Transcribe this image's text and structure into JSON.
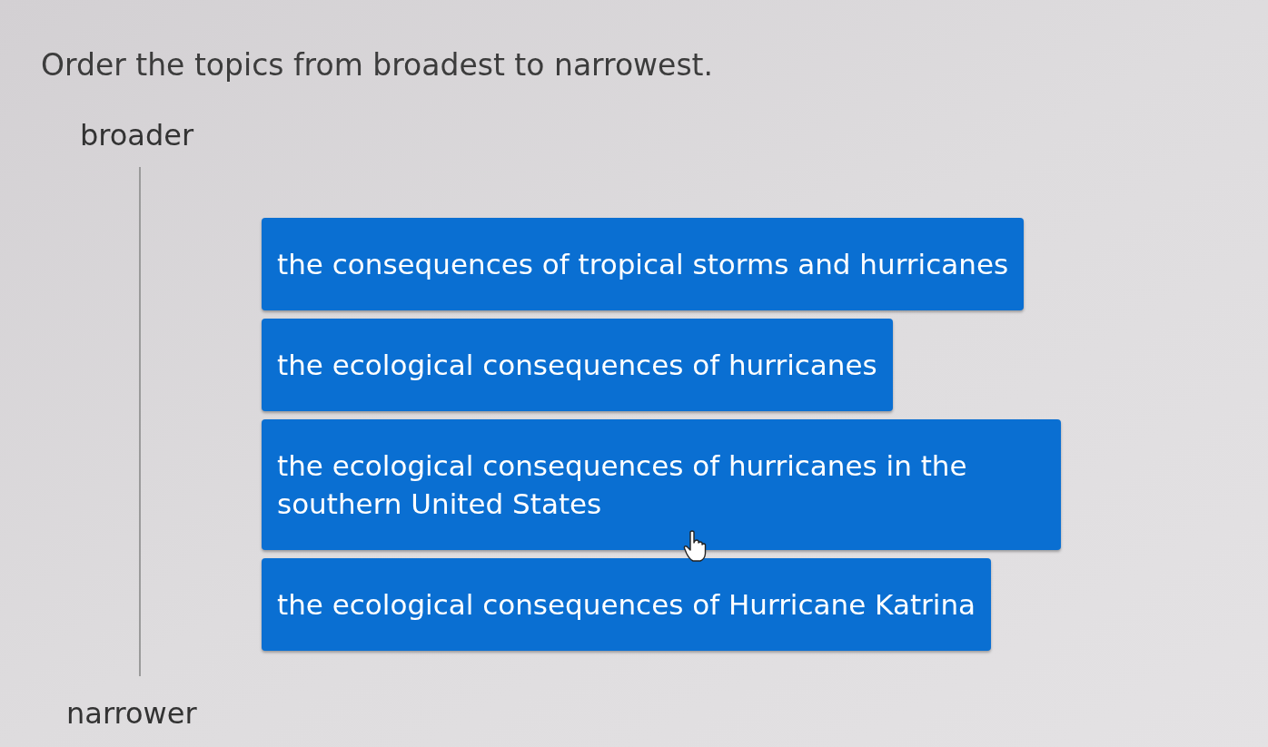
{
  "prompt": "Order the topics from broadest to narrowest.",
  "top_label": "broader",
  "items": [
    {
      "text": "the consequences of tropical storms and hurricanes"
    },
    {
      "text": "the ecological consequences of hurricanes"
    },
    {
      "text": "the ecological consequences of hurricanes in the southern United States"
    },
    {
      "text": "the ecological consequences of Hurricane Katrina"
    }
  ],
  "bottom_label": "narrower"
}
